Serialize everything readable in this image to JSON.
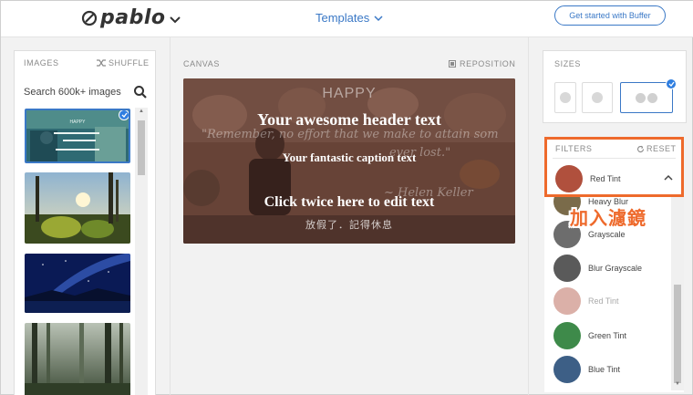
{
  "header": {
    "logo_text": "pablo",
    "templates_label": "Templates",
    "cta_label": "Get started with Buffer"
  },
  "images": {
    "title": "IMAGES",
    "shuffle_label": "SHUFFLE",
    "search_placeholder": "Search 600k+ images"
  },
  "canvas": {
    "title": "CANVAS",
    "reposition_label": "REPOSITION",
    "bg_word": "HAPPY",
    "header_text": "Your awesome header text",
    "quote_text": "\"Remember, no effort that we make to attain som",
    "quote_text_2": "ever lost.\"",
    "caption_text": "Your fantastic caption text",
    "author_text": "~ Helen Keller",
    "edit_text": "Click twice here to edit text",
    "sub_text": "放假了．記得休息"
  },
  "sizes": {
    "title": "SIZES"
  },
  "filters": {
    "title": "FILTERS",
    "reset_label": "RESET",
    "selected": {
      "name": "Red Tint",
      "color": "#b0503d"
    },
    "items": [
      {
        "name": "Heavy Blur",
        "color": "#7a6b4a"
      },
      {
        "name": "Grayscale",
        "color": "#6d6d6d"
      },
      {
        "name": "Blur Grayscale",
        "color": "#5a5a5a"
      },
      {
        "name": "Red Tint",
        "color": "#c9a195"
      },
      {
        "name": "Green Tint",
        "color": "#3e8a4a"
      },
      {
        "name": "Blue Tint",
        "color": "#3d5f86"
      }
    ]
  },
  "annotation": "加入濾鏡",
  "colors": {
    "accent": "#3a78c6",
    "highlight": "#ee6a2c"
  }
}
